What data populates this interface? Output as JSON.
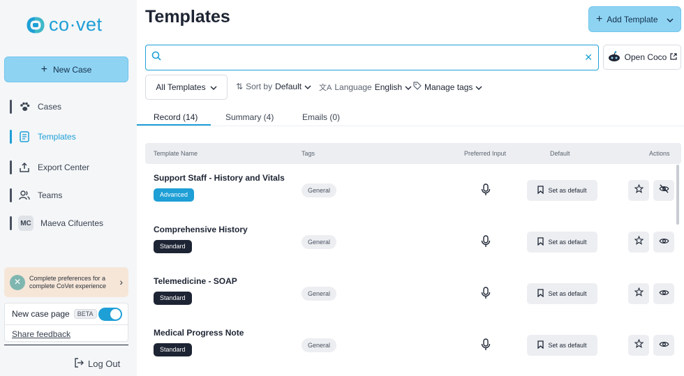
{
  "brand": {
    "name": "co·vet",
    "color": "#1e9fd6"
  },
  "sidebar": {
    "new_case_label": "New Case",
    "items": [
      {
        "label": "Cases",
        "icon": "paw-icon"
      },
      {
        "label": "Templates",
        "icon": "document-icon",
        "active": true
      },
      {
        "label": "Export Center",
        "icon": "export-icon"
      },
      {
        "label": "Teams",
        "icon": "users-icon"
      },
      {
        "label": "Maeva Cifuentes",
        "initials": "MC"
      }
    ],
    "promo_text": "Complete preferences for a complete CoVet experience",
    "new_case_page_label": "New case page",
    "beta_label": "BETA",
    "share_feedback_label": "Share feedback",
    "logout_label": "Log Out"
  },
  "header": {
    "title": "Templates",
    "add_template_label": "Add Template",
    "search_placeholder": "",
    "search_value": "",
    "open_coco_label": "Open Coco"
  },
  "filters": {
    "all_templates_label": "All Templates",
    "sort_label": "Sort by",
    "sort_value": "Default",
    "language_label": "Language",
    "language_value": "English",
    "manage_tags_label": "Manage tags"
  },
  "tabs": [
    {
      "label": "Record (14)",
      "active": true
    },
    {
      "label": "Summary (4)"
    },
    {
      "label": "Emails (0)"
    }
  ],
  "table": {
    "columns": [
      "Template Name",
      "Tags",
      "Preferred Input",
      "Default",
      "Actions"
    ],
    "set_default_label": "Set as default",
    "rows": [
      {
        "name": "Support Staff - History and Vitals",
        "badge": "Advanced",
        "tag": "General",
        "visibility": "eye-off-icon"
      },
      {
        "name": "Comprehensive History",
        "badge": "Standard",
        "tag": "General",
        "visibility": "eye-icon"
      },
      {
        "name": "Telemedicine - SOAP",
        "badge": "Standard",
        "tag": "General",
        "visibility": "eye-icon"
      },
      {
        "name": "Medical Progress Note",
        "badge": "Standard",
        "tag": "General",
        "visibility": "eye-icon"
      }
    ]
  }
}
